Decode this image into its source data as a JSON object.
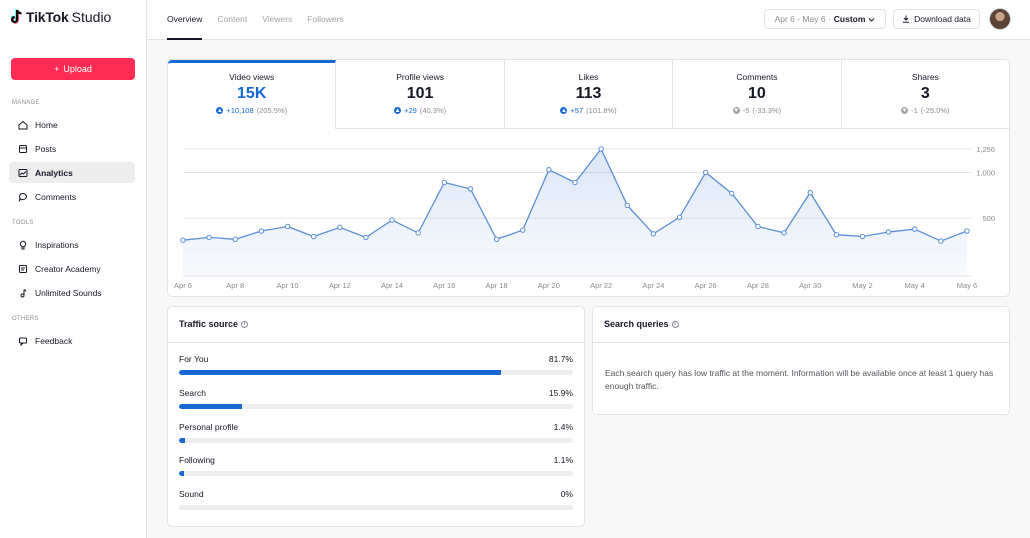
{
  "app": {
    "logo_text": "TikTok",
    "logo_suffix": "Studio"
  },
  "sidebar": {
    "upload_label": "Upload",
    "sections": {
      "manage": "MANAGE",
      "tools": "TOOLS",
      "others": "OTHERS"
    },
    "items": [
      {
        "label": "Home",
        "icon": "home-icon"
      },
      {
        "label": "Posts",
        "icon": "posts-icon"
      },
      {
        "label": "Analytics",
        "icon": "analytics-icon",
        "active": true
      },
      {
        "label": "Comments",
        "icon": "comment-icon"
      },
      {
        "label": "Inspirations",
        "icon": "lightbulb-icon"
      },
      {
        "label": "Creator Academy",
        "icon": "academy-icon"
      },
      {
        "label": "Unlimited Sounds",
        "icon": "music-note-icon"
      },
      {
        "label": "Feedback",
        "icon": "feedback-icon"
      }
    ]
  },
  "topbar": {
    "tabs": [
      {
        "label": "Overview",
        "active": true
      },
      {
        "label": "Content"
      },
      {
        "label": "Viewers"
      },
      {
        "label": "Followers"
      }
    ],
    "date_range": "Apr 6 - May 6 ·",
    "date_mode": "Custom",
    "download_label": "Download data"
  },
  "metrics": [
    {
      "label": "Video views",
      "value": "15K",
      "change": "+10,108",
      "pct": "(205.5%)",
      "dir": "up",
      "active": true
    },
    {
      "label": "Profile views",
      "value": "101",
      "change": "+29",
      "pct": "(40.3%)",
      "dir": "up"
    },
    {
      "label": "Likes",
      "value": "113",
      "change": "+57",
      "pct": "(101.8%)",
      "dir": "up"
    },
    {
      "label": "Comments",
      "value": "10",
      "change": "-5",
      "pct": "(-33.3%)",
      "dir": "down"
    },
    {
      "label": "Shares",
      "value": "3",
      "change": "-1",
      "pct": "(-25.0%)",
      "dir": "down"
    }
  ],
  "chart_data": {
    "type": "area",
    "x_labels": [
      "Apr 6",
      "Apr 8",
      "Apr 10",
      "Apr 12",
      "Apr 14",
      "Apr 16",
      "Apr 18",
      "Apr 20",
      "Apr 22",
      "Apr 24",
      "Apr 26",
      "Apr 28",
      "Apr 30",
      "May 2",
      "May 4",
      "May 6"
    ],
    "x": [
      "Apr 6",
      "Apr 7",
      "Apr 8",
      "Apr 9",
      "Apr 10",
      "Apr 11",
      "Apr 12",
      "Apr 13",
      "Apr 14",
      "Apr 15",
      "Apr 16",
      "Apr 17",
      "Apr 18",
      "Apr 19",
      "Apr 20",
      "Apr 21",
      "Apr 22",
      "Apr 23",
      "Apr 24",
      "Apr 25",
      "Apr 26",
      "Apr 27",
      "Apr 28",
      "Apr 29",
      "Apr 30",
      "May 1",
      "May 2",
      "May 3",
      "May 4",
      "May 5",
      "May 6"
    ],
    "values": [
      260,
      290,
      270,
      360,
      410,
      300,
      400,
      290,
      480,
      340,
      890,
      820,
      270,
      370,
      1030,
      890,
      1256,
      640,
      330,
      510,
      1000,
      770,
      410,
      340,
      780,
      320,
      300,
      350,
      380,
      250,
      360
    ],
    "y_ticks": [
      500,
      1000,
      1256
    ],
    "y_tick_labels": [
      "500",
      "1,000",
      "1,256"
    ],
    "ylim": [
      0,
      1256
    ],
    "color": "#5b8fd6"
  },
  "traffic": {
    "title": "Traffic source",
    "sources": [
      {
        "label": "For You",
        "value": "81.7%",
        "pct": 81.7
      },
      {
        "label": "Search",
        "value": "15.9%",
        "pct": 15.9
      },
      {
        "label": "Personal profile",
        "value": "1.4%",
        "pct": 1.4
      },
      {
        "label": "Following",
        "value": "1.1%",
        "pct": 1.1
      },
      {
        "label": "Sound",
        "value": "0%",
        "pct": 0
      }
    ]
  },
  "search_queries": {
    "title": "Search queries",
    "message": "Each search query has low traffic at the moment. Information will be available once at least 1 query has enough traffic."
  },
  "colors": {
    "accent": "#1768d3",
    "brand": "#fe2c55"
  }
}
